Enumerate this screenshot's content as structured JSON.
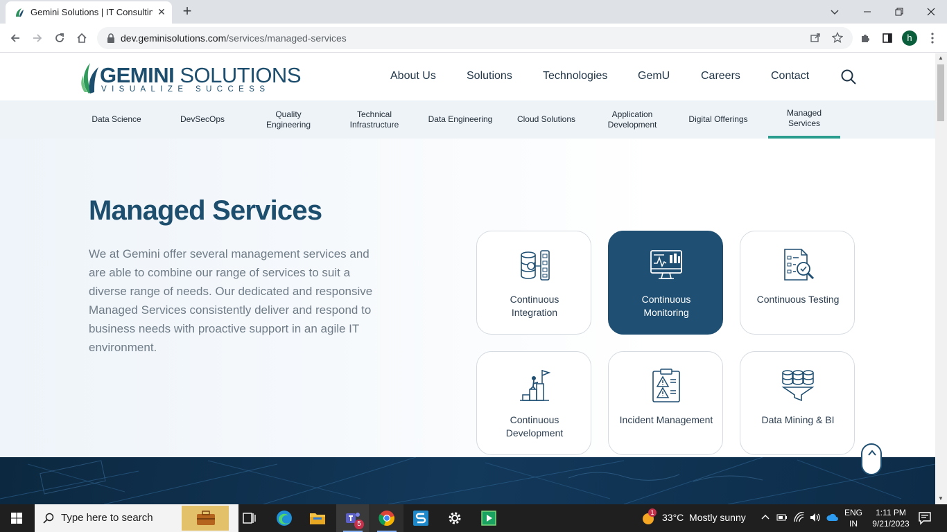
{
  "browser": {
    "tab_title": "Gemini Solutions | IT Consulting",
    "tab_close": "✕",
    "new_tab": "+",
    "url_host": "dev.geminisolutions.com",
    "url_path": "/services/managed-services",
    "profile_initial": "h"
  },
  "site": {
    "logo_word_bold": "GEMINI",
    "logo_word_light": " SOLUTIONS",
    "logo_tagline": "VISUALIZE SUCCESS",
    "nav": [
      "About Us",
      "Solutions",
      "Technologies",
      "GemU",
      "Careers",
      "Contact"
    ],
    "subnav": [
      "Data Science",
      "DevSecOps",
      "Quality Engineering",
      "Technical Infrastructure",
      "Data Engineering",
      "Cloud Solutions",
      "Application Development",
      "Digital Offerings",
      "Managed Services"
    ],
    "subnav_active": "Managed Services"
  },
  "hero": {
    "title": "Managed Services",
    "description": "We at Gemini offer several management services and are able to combine our range of services to suit a diverse range of needs. Our dedicated and responsive Managed Services consistently deliver and respond to business needs with proactive support in an agile IT environment."
  },
  "cards": [
    {
      "label_line1": "Continuous",
      "label_line2": "Integration",
      "icon": "integration-icon"
    },
    {
      "label_line1": "Continuous",
      "label_line2": "Monitoring",
      "icon": "monitoring-icon",
      "active": true
    },
    {
      "label_line1": "Continuous Testing",
      "label_line2": "",
      "icon": "testing-icon"
    },
    {
      "label_line1": "Continuous",
      "label_line2": "Development",
      "icon": "development-icon"
    },
    {
      "label_line1": "Incident Management",
      "label_line2": "",
      "icon": "incident-icon"
    },
    {
      "label_line1": "Data Mining & BI",
      "label_line2": "",
      "icon": "data-mining-icon"
    }
  ],
  "colors": {
    "brand_navy": "#1f4f72",
    "accent_teal": "#2a9d8f"
  },
  "taskbar": {
    "search_placeholder": "Type here to search",
    "weather": "33°C  Mostly sunny",
    "weather_badge": "1",
    "teams_badge": "5",
    "lang_line1": "ENG",
    "lang_line2": "IN",
    "time": "1:11 PM",
    "date": "9/21/2023"
  }
}
